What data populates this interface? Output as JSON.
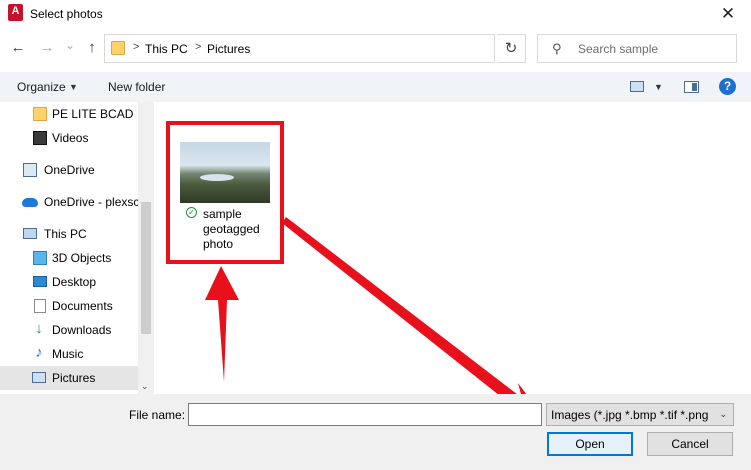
{
  "window": {
    "title": "Select photos",
    "app_icon_letter": "A",
    "close_glyph": "✕"
  },
  "nav": {
    "back_glyph": "←",
    "forward_glyph": "→",
    "recent_glyph": "⌄",
    "up_glyph": "↑",
    "breadcrumb": [
      "This PC",
      "Pictures"
    ],
    "chevron": ">",
    "dropdown_glyph": "⌄",
    "refresh_glyph": "↻",
    "search_glyph": "⚲",
    "search_placeholder": "Search sample"
  },
  "toolbar": {
    "organize_label": "Organize",
    "caret_glyph": "▼",
    "new_folder_label": "New folder",
    "help_glyph": "?"
  },
  "sidebar": {
    "items": [
      {
        "label": "PE LITE BCAD",
        "icon": "folder-icon"
      },
      {
        "label": "Videos",
        "icon": "videos-icon"
      },
      {
        "label": "OneDrive",
        "icon": "onedrive-icon"
      },
      {
        "label": "OneDrive - plexsc",
        "icon": "onedrive-cloud-icon"
      },
      {
        "label": "This PC",
        "icon": "this-pc-icon"
      },
      {
        "label": "3D Objects",
        "icon": "3d-objects-icon"
      },
      {
        "label": "Desktop",
        "icon": "desktop-icon"
      },
      {
        "label": "Documents",
        "icon": "documents-icon"
      },
      {
        "label": "Downloads",
        "icon": "downloads-icon"
      },
      {
        "label": "Music",
        "icon": "music-icon"
      },
      {
        "label": "Pictures",
        "icon": "pictures-icon"
      }
    ],
    "selected_index": 10,
    "scroll_down_glyph": "⌄",
    "download_glyph": "↓",
    "music_glyph": "♪"
  },
  "files": [
    {
      "name": "sample geotagged photo",
      "status_glyph": "✓"
    }
  ],
  "footer": {
    "file_name_label": "File name:",
    "file_name_value": "",
    "filter_text": "Images (*.jpg *.bmp *.tif *.png",
    "filter_caret": "⌄",
    "open_label": "Open",
    "cancel_label": "Cancel"
  },
  "colors": {
    "accent": "#0078d7",
    "annotation_red": "#e8101a"
  }
}
